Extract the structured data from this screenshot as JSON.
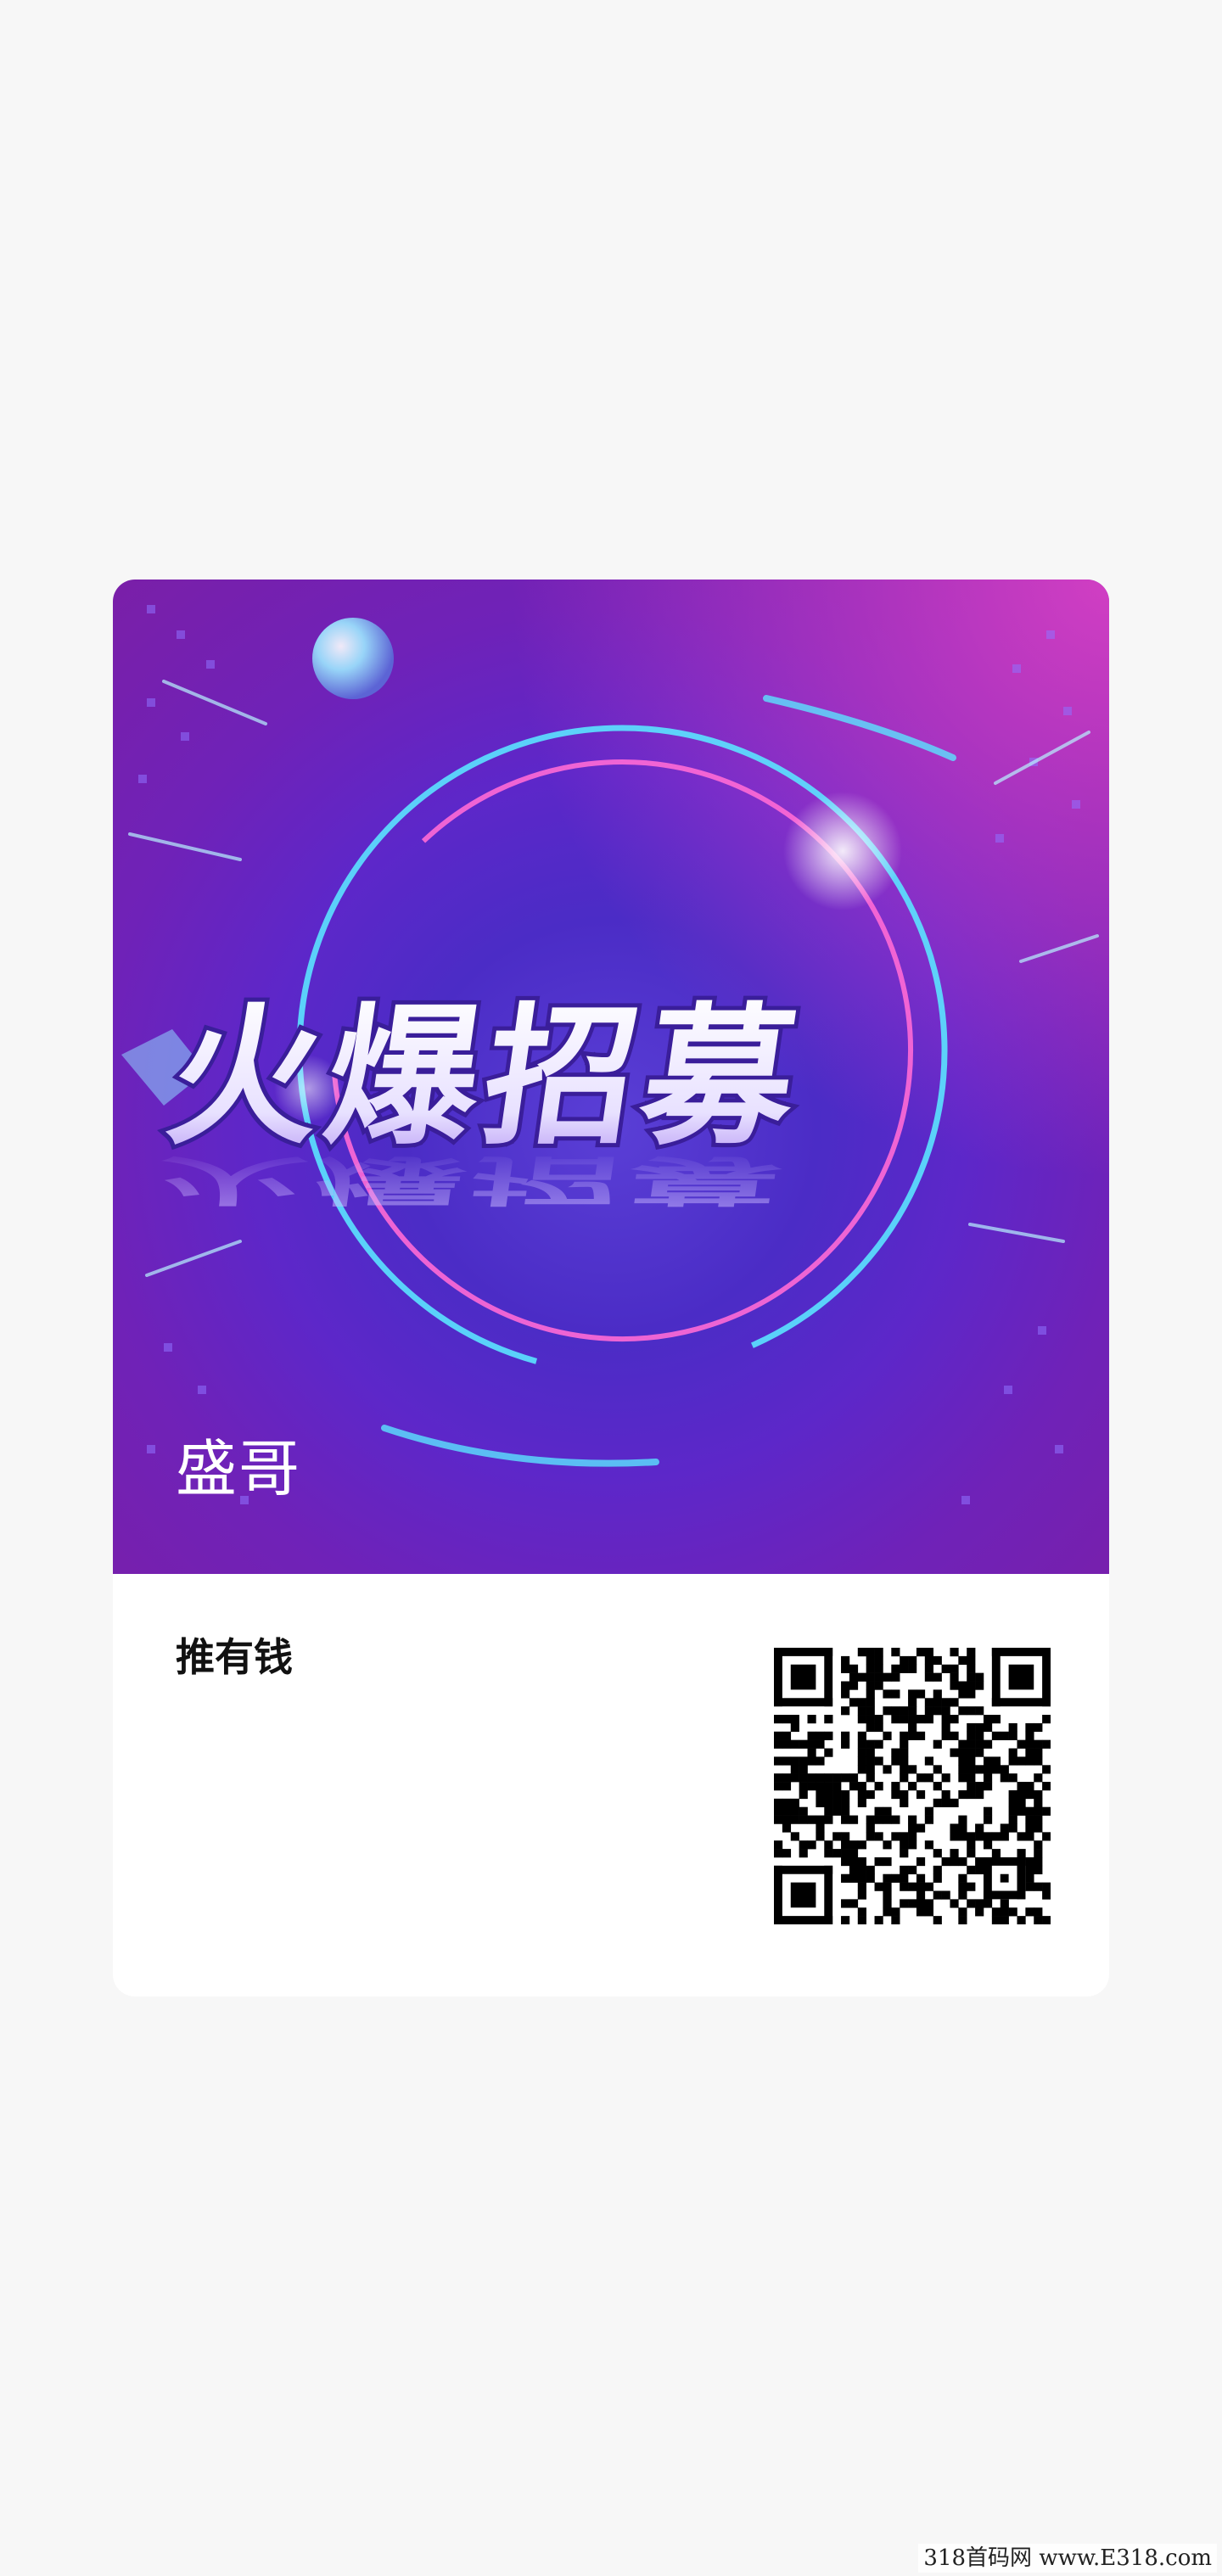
{
  "poster": {
    "title_text": "火爆招募",
    "author": "盛哥",
    "colors": {
      "bg_dark": "#4b2cc6",
      "bg_magenta": "#c43bd6",
      "ring_cyan": "#5be3ff",
      "ring_pink": "#ff6ad5"
    }
  },
  "card": {
    "app_name": "推有钱",
    "qr_icon": "qr-code-icon"
  },
  "watermark": "318首码网 www.E318.com"
}
